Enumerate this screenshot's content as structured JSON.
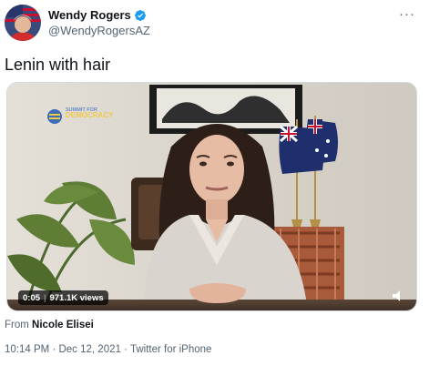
{
  "author": {
    "display_name": "Wendy Rogers",
    "handle": "@WendyRogersAZ",
    "verified_icon": "verified-badge-icon"
  },
  "tweet": {
    "text": "Lenin with hair"
  },
  "media": {
    "type": "video",
    "watermark_line1": "SUMMIT FOR",
    "watermark_line2": "DEMOCRACY",
    "elapsed": "0:05",
    "views": "971.1K views"
  },
  "attribution": {
    "prefix": "From",
    "source_name": "Nicole Elisei"
  },
  "meta": {
    "time": "10:14 PM",
    "separator": "·",
    "date": "Dec 12, 2021",
    "client": "Twitter for iPhone"
  },
  "colors": {
    "verified_blue": "#1d9bf0",
    "secondary_text": "#536471",
    "primary_text": "#0f1419"
  }
}
